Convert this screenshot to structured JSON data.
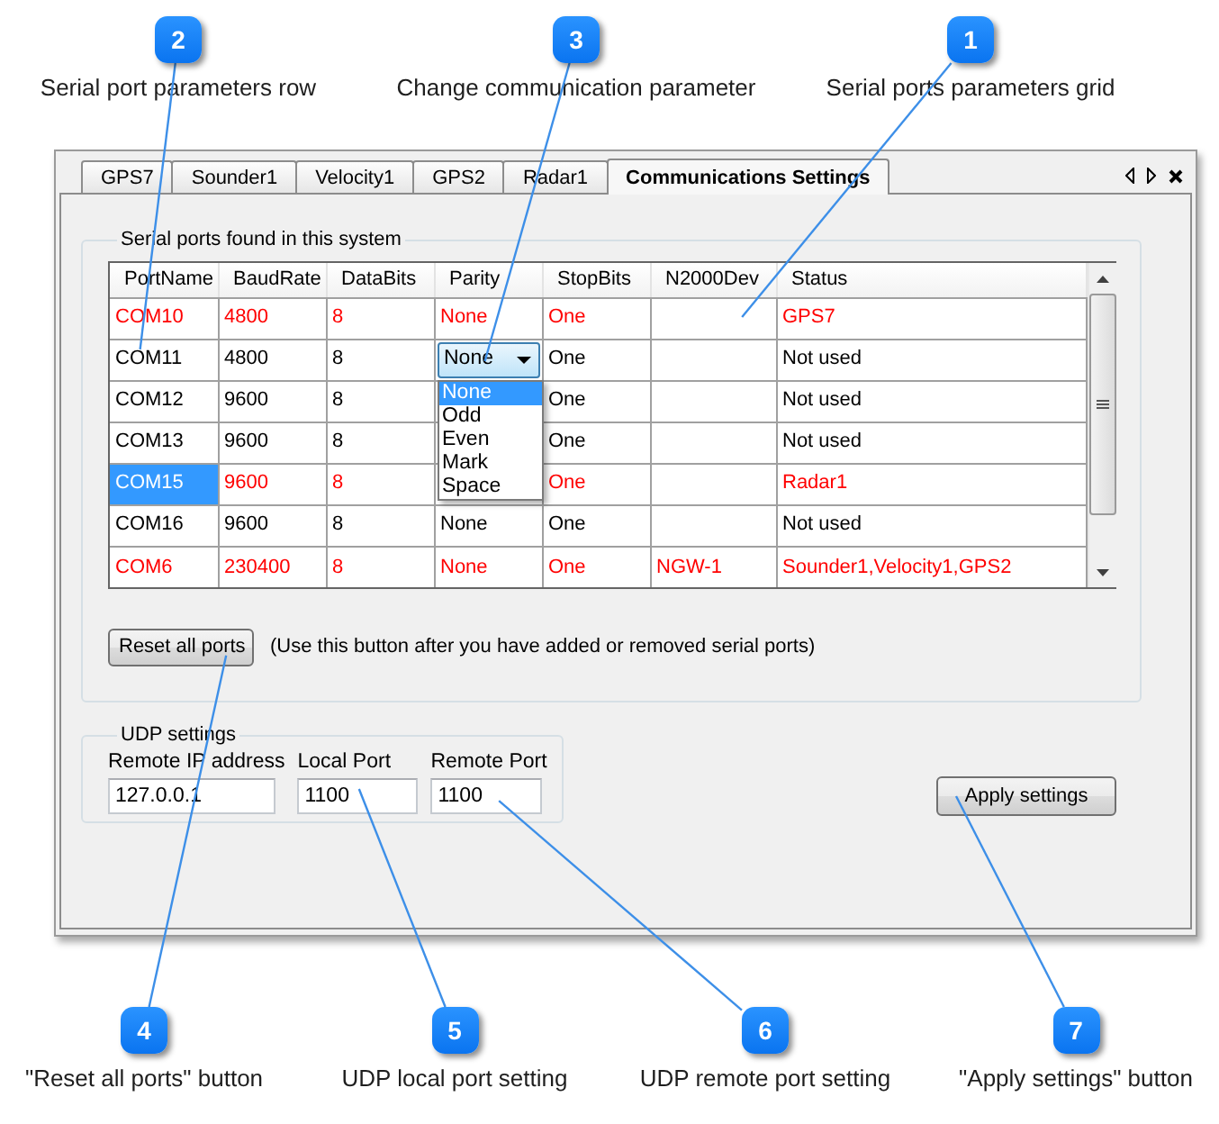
{
  "callouts_top": [
    {
      "number": "2",
      "label": "Serial port parameters row"
    },
    {
      "number": "3",
      "label": "Change communication parameter"
    },
    {
      "number": "1",
      "label": "Serial ports parameters grid"
    }
  ],
  "window": {
    "tabs": [
      {
        "label": "GPS7",
        "selected": false
      },
      {
        "label": "Sounder1",
        "selected": false
      },
      {
        "label": "Velocity1",
        "selected": false
      },
      {
        "label": "GPS2",
        "selected": false
      },
      {
        "label": "Radar1",
        "selected": false
      },
      {
        "label": "Communications Settings",
        "selected": true
      }
    ],
    "serial_ports": {
      "title": "Serial ports found in this system",
      "columns": [
        "PortName",
        "BaudRate",
        "DataBits",
        "Parity",
        "StopBits",
        "N2000Dev",
        "Status"
      ],
      "rows": [
        {
          "port_name": "COM10",
          "baud_rate": "4800",
          "data_bits": "8",
          "parity": "None",
          "stop_bits": "One",
          "status": "GPS7",
          "color": "#ff0000",
          "selected": false,
          "editing": false
        },
        {
          "port_name": "COM11",
          "baud_rate": "4800",
          "data_bits": "8",
          "parity": "None",
          "stop_bits": "One",
          "status": "Not used",
          "color": "#000000",
          "selected": false,
          "editing": true
        },
        {
          "port_name": "COM12",
          "baud_rate": "9600",
          "data_bits": "8",
          "stop_bits": "One",
          "status": "Not used",
          "color": "#000000",
          "selected": false,
          "editing": false
        },
        {
          "port_name": "COM13",
          "baud_rate": "9600",
          "data_bits": "8",
          "stop_bits": "One",
          "status": "Not used",
          "color": "#000000",
          "selected": false,
          "editing": false
        },
        {
          "port_name": "COM15",
          "baud_rate": "9600",
          "data_bits": "8",
          "stop_bits": "One",
          "status": "Radar1",
          "color": "#ff0000",
          "selected": true,
          "editing": false
        },
        {
          "port_name": "COM16",
          "baud_rate": "9600",
          "data_bits": "8",
          "parity": "None",
          "stop_bits": "One",
          "status": "Not used",
          "color": "#000000",
          "selected": false,
          "editing": false
        },
        {
          "port_name": "COM6",
          "baud_rate": "230400",
          "data_bits": "8",
          "parity": "None",
          "stop_bits": "One",
          "n2000_dev": "NGW-1",
          "status": "Sounder1,Velocity1,GPS2",
          "color": "#ff0000",
          "selected": false,
          "editing": false
        }
      ],
      "parity_dropdown": {
        "expanded": true,
        "options": [
          {
            "label": "None",
            "selected": true
          },
          {
            "label": "Odd",
            "selected": false
          },
          {
            "label": "Even",
            "selected": false
          },
          {
            "label": "Mark",
            "selected": false
          },
          {
            "label": "Space",
            "selected": false
          }
        ]
      },
      "reset_button": "Reset all ports",
      "reset_hint": "(Use this button after you have added or removed serial ports)"
    },
    "udp_settings": {
      "title": "UDP settings",
      "fields": [
        {
          "label": "Remote IP address",
          "value": "127.0.0.1"
        },
        {
          "label": "Local Port",
          "value": "1100"
        },
        {
          "label": "Remote Port",
          "value": "1100"
        }
      ]
    },
    "apply_button": "Apply settings"
  },
  "callouts_bottom": [
    {
      "number": "4",
      "label": "\"Reset all ports\" button"
    },
    {
      "number": "5",
      "label": "UDP local port setting"
    },
    {
      "number": "6",
      "label": "UDP remote port setting"
    },
    {
      "number": "7",
      "label": "\"Apply settings\" button"
    }
  ]
}
